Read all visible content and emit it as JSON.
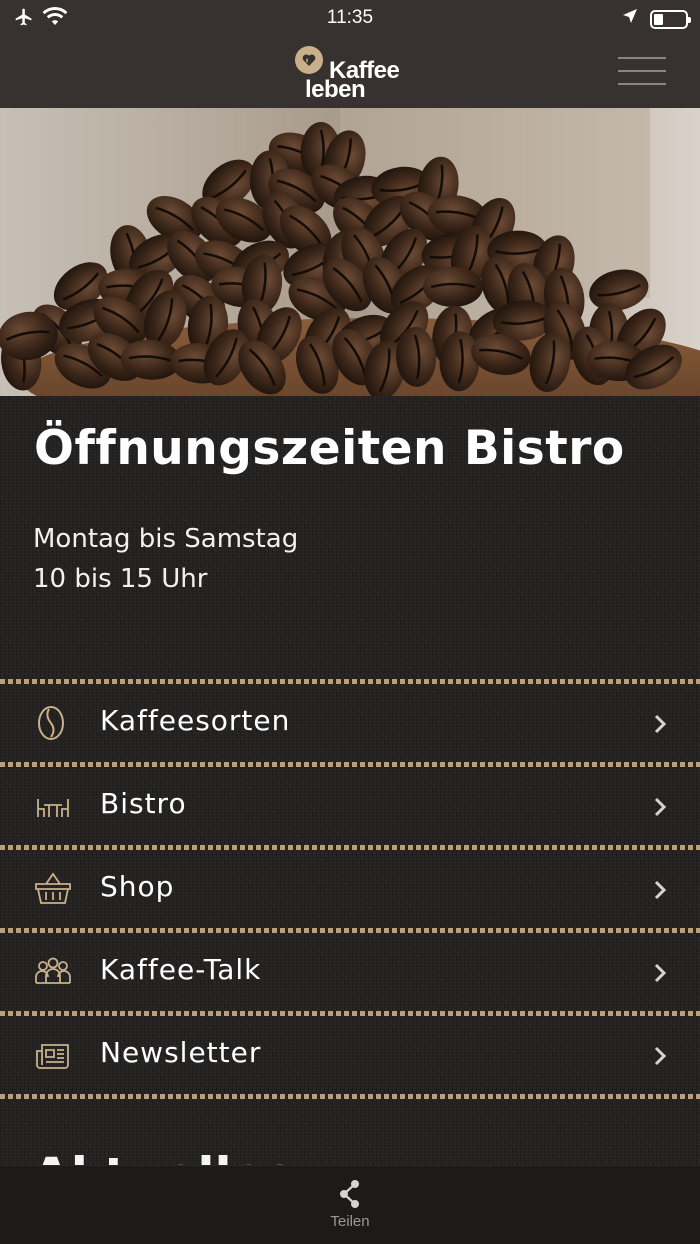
{
  "status_bar": {
    "time": "11:35",
    "icons": [
      "airplane-icon",
      "wifi-icon",
      "location-icon",
      "battery-icon"
    ]
  },
  "header": {
    "logo_line1": "Kaffee",
    "logo_line2": "leben",
    "menu_icon": "hamburger-icon"
  },
  "hero": {
    "image_subject": "coffee-beans"
  },
  "hours": {
    "title": "Öffnungszeiten Bistro",
    "days": "Montag bis Samstag",
    "time": "10 bis 15 Uhr"
  },
  "menu": {
    "items": [
      {
        "label": "Kaffeesorten",
        "icon": "coffee-bean-icon"
      },
      {
        "label": "Bistro",
        "icon": "table-icon"
      },
      {
        "label": "Shop",
        "icon": "basket-icon"
      },
      {
        "label": "Kaffee-Talk",
        "icon": "people-icon"
      },
      {
        "label": "Newsletter",
        "icon": "newspaper-icon"
      }
    ]
  },
  "section_heading": "Aktuelles",
  "tab_bar": {
    "share_label": "Teilen",
    "share_icon": "share-icon"
  },
  "colors": {
    "header_bg": "#37322f",
    "accent_gold": "#b9a07d",
    "icon_gold": "#c9b08a",
    "tab_bar_bg": "#1d1b1a",
    "chevron": "#d8d3cd"
  }
}
